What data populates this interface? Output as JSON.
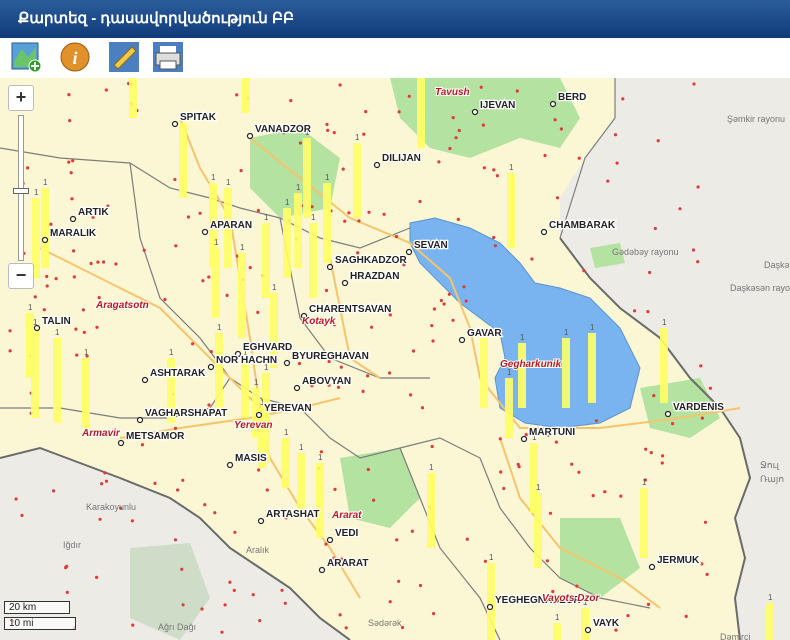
{
  "title": "Քարտեզ - դասավորվածություն ԲԲ",
  "toolbar": {
    "buttons": [
      {
        "name": "add-map-button",
        "icon": "map-add-icon"
      },
      {
        "name": "info-button",
        "icon": "info-icon"
      },
      {
        "name": "measure-button",
        "icon": "ruler-icon"
      },
      {
        "name": "print-button",
        "icon": "printer-icon"
      }
    ]
  },
  "zoom": {
    "in_label": "+",
    "out_label": "−",
    "level": 0.7
  },
  "scale": {
    "km": "20 km",
    "mi": "10 mi"
  },
  "map": {
    "colors": {
      "land": "#fbf6d4",
      "lake": "#79b3f0",
      "forest": "#b4e2a0",
      "bars": "#ffff66",
      "dots": "#e23a3a",
      "border": "#7d7d7d",
      "roads": "#f6c46b",
      "foreign": "#ecebe6"
    },
    "regions": [
      "Tavush",
      "Aragatsotn",
      "Kotayk",
      "Gegharkunik",
      "Armavir",
      "Yerevan",
      "Ararat",
      "Vayots Dzor"
    ],
    "cities": [
      "SPITAK",
      "VANADZOR",
      "IJEVAN",
      "BERD",
      "DILIJAN",
      "ARTIK",
      "MARALIK",
      "APARAN",
      "CHAMBARAK",
      "SEVAN",
      "SAGHKADZOR",
      "HRAZDAN",
      "CHARENTSAVAN",
      "TALIN",
      "GAVAR",
      "EGHVARD",
      "ASHTARAK",
      "NOR HACHN",
      "BYUREGHAVAN",
      "ABOVYAN",
      "VAGHARSHAPAT",
      "YEREVAN",
      "MARTUNI",
      "VARDENIS",
      "METSAMOR",
      "MASIS",
      "ARTASHAT",
      "VEDI",
      "ARARAT",
      "JERMUK",
      "YEGHEGNADZOR",
      "VAYK"
    ],
    "foreign_labels": [
      "Şəmkir rayonu",
      "Gədəbəy rayonu",
      "Daşkə",
      "Daşkəsən rayonu",
      "Karakoyunlu",
      "Iğdır",
      "Aralık",
      "Ağrı Dağı",
      "Sədərək",
      "Dəmirçi",
      "Ջուլ",
      "Ռայո"
    ],
    "bar_count_label": "1"
  }
}
